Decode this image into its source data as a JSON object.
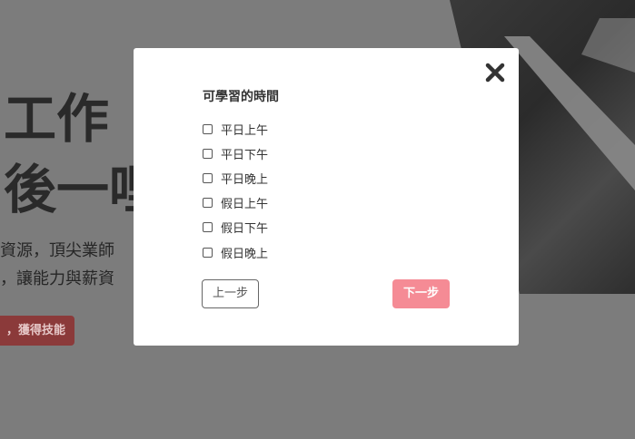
{
  "background": {
    "hero_title_line1": "工作",
    "hero_title_line2": "後一哩",
    "hero_desc_line1": "資源，頂尖業師",
    "hero_desc_line2": "，讓能力與薪資",
    "hero_cta_label": "，獲得技能"
  },
  "modal": {
    "title": "可學習的時間",
    "close_icon": "close-icon",
    "options": [
      {
        "label": "平日上午",
        "checked": false
      },
      {
        "label": "平日下午",
        "checked": false
      },
      {
        "label": "平日晚上",
        "checked": false
      },
      {
        "label": "假日上午",
        "checked": false
      },
      {
        "label": "假日下午",
        "checked": false
      },
      {
        "label": "假日晚上",
        "checked": false
      }
    ],
    "prev_label": "上一步",
    "next_label": "下一步"
  },
  "colors": {
    "next_button": "#f58b95",
    "overlay": "#7c7c7c"
  }
}
